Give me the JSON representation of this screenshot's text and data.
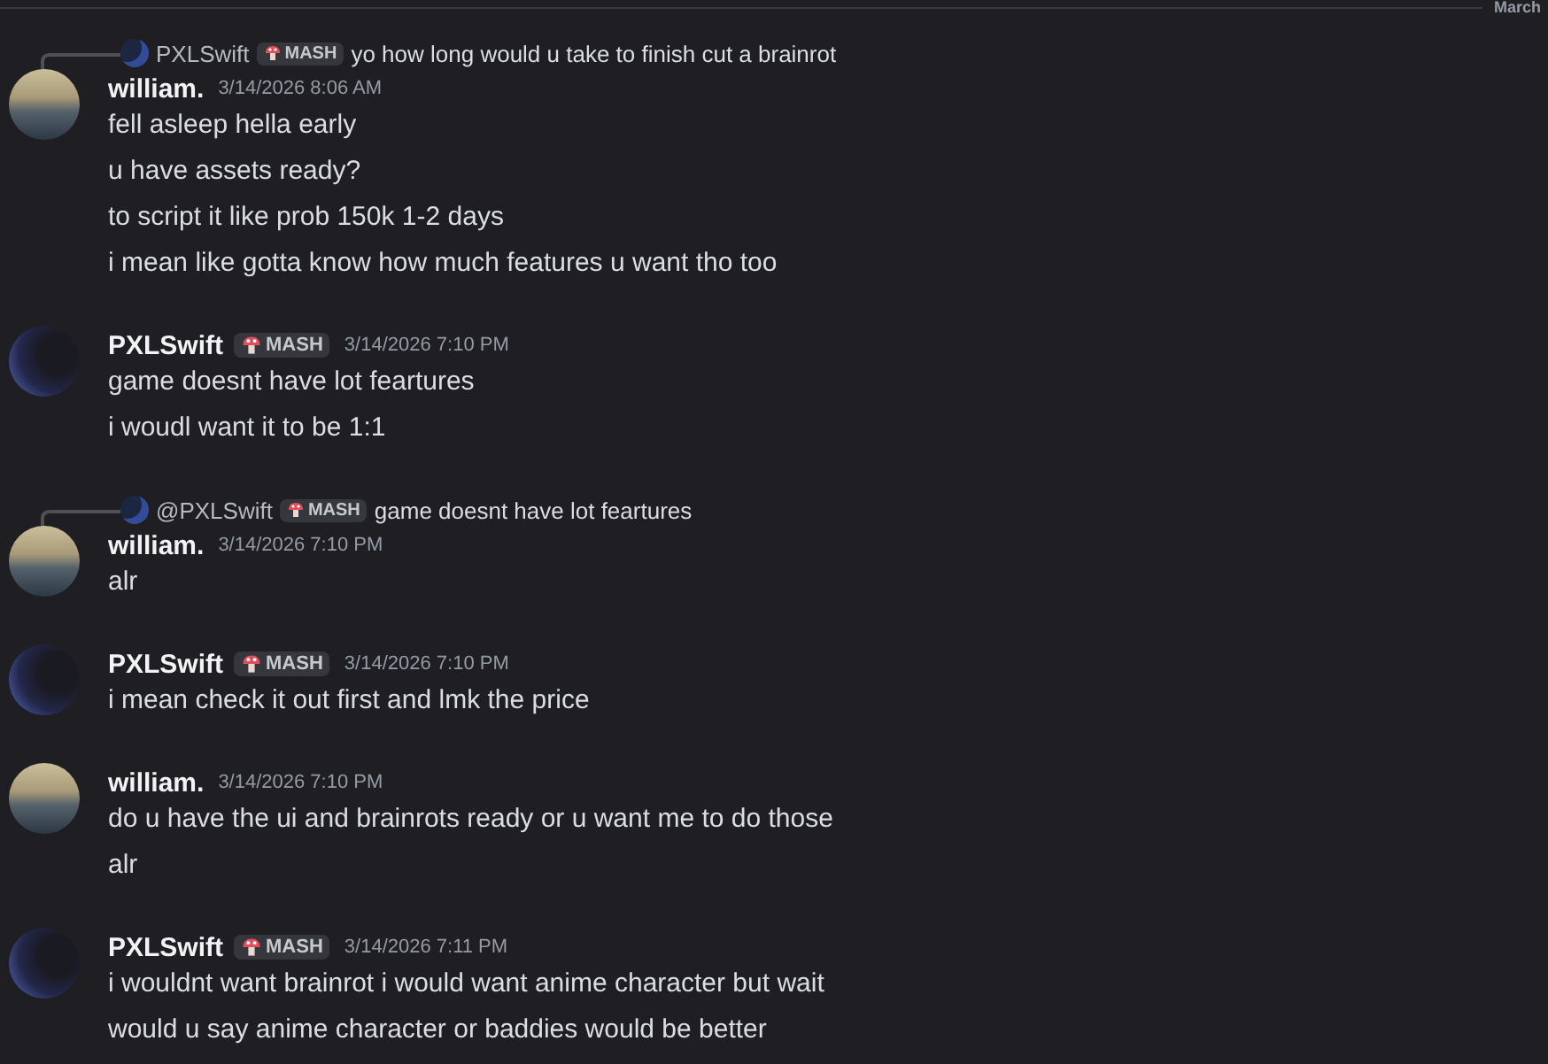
{
  "divider": {
    "label": "March"
  },
  "messages": [
    {
      "kind": "sea",
      "reply": {
        "author": "PXLSwift",
        "tag": "MASH",
        "text": "yo how long would u take to finish cut a brainrot"
      },
      "author": "william.",
      "timestamp": "3/14/2026 8:06 AM",
      "lines": [
        "fell asleep hella early",
        "u have assets ready?",
        "to script it like prob 150k 1-2 days",
        "i mean like gotta know how much features u want tho too"
      ]
    },
    {
      "kind": "dark",
      "author": "PXLSwift",
      "tag": "MASH",
      "timestamp": "3/14/2026 7:10 PM",
      "lines": [
        "game doesnt have lot feartures",
        "i woudl want it to be 1:1"
      ]
    },
    {
      "kind": "sea",
      "reply": {
        "author": "@PXLSwift",
        "tag": "MASH",
        "text": "game doesnt have lot feartures"
      },
      "author": "william.",
      "timestamp": "3/14/2026 7:10 PM",
      "lines": [
        "alr"
      ]
    },
    {
      "kind": "dark",
      "author": "PXLSwift",
      "tag": "MASH",
      "timestamp": "3/14/2026 7:10 PM",
      "lines": [
        "i mean check it out first and lmk the price"
      ]
    },
    {
      "kind": "sea",
      "author": "william.",
      "timestamp": "3/14/2026 7:10 PM",
      "lines": [
        "do u have the ui and brainrots ready or u want me to do those",
        "alr"
      ]
    },
    {
      "kind": "dark",
      "author": "PXLSwift",
      "tag": "MASH",
      "timestamp": "3/14/2026 7:11 PM",
      "lines": [
        "i wouldnt want brainrot i would want anime character but wait",
        "would u say anime character or baddies would be better"
      ]
    }
  ]
}
